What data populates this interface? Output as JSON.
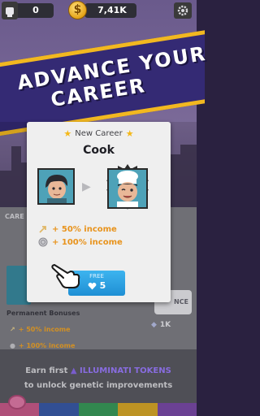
{
  "topbar": {
    "tokens": "0",
    "money": "7,41K",
    "coin_symbol": "$"
  },
  "banner": {
    "line1": "ADVANCE YOUR",
    "line2": "CAREER"
  },
  "dialog": {
    "subtitle": "New Career",
    "title": "Cook",
    "bonuses": [
      {
        "text": "+ 50% income",
        "icon": "raise-icon"
      },
      {
        "text": "+ 100% income",
        "icon": "silver-coin-icon"
      }
    ],
    "buy_button": {
      "label": "FREE",
      "price": "5",
      "price_icon": "heart-gem-icon"
    }
  },
  "background": {
    "career_label": "CARE",
    "permanent_label": "Permanent Bonuses",
    "bonuses": [
      "+ 50% income",
      "+ 100% income"
    ],
    "right_button": "NCE",
    "right_price": "1K",
    "earn_line1_prefix": "Earn first",
    "earn_line1_highlight": "ILLUMINATI TOKENS",
    "earn_line2": "to unlock genetic improvements"
  },
  "colors": {
    "banner": "#342a74",
    "banner_border": "#f2b820",
    "buy_button": "#2aa3e4",
    "bonus_text": "#e8931c"
  }
}
